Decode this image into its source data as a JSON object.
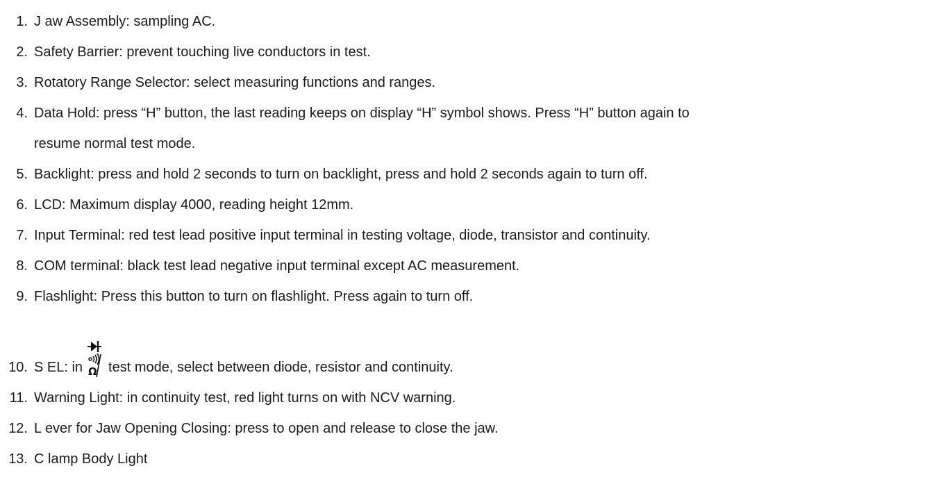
{
  "items": [
    {
      "num": "1.",
      "text": "J aw Assembly: sampling AC."
    },
    {
      "num": "2.",
      "text": "Safety Barrier: prevent touching live conductors in test."
    },
    {
      "num": "3.",
      "text": "Rotatory Range Selector: select measuring functions and ranges."
    },
    {
      "num": "4.",
      "line1": "Data Hold: press “H” button, the last reading keeps on display “H” symbol shows. Press “H” button again to",
      "line2": "resume normal test mode."
    },
    {
      "num": "5.",
      "text": "Backlight: press and hold 2 seconds to turn on backlight, press and hold 2 seconds again to turn off."
    },
    {
      "num": "6.",
      "text": "LCD: Maximum display 4000, reading height 12mm."
    },
    {
      "num": "7.",
      "text": "Input Terminal: red test lead positive input terminal in testing voltage, diode, transistor and continuity."
    },
    {
      "num": "8.",
      "text": "COM terminal: black test lead negative input terminal except AC measurement."
    },
    {
      "num": "9.",
      "text": "Flashlight: Press this button to turn on flashlight. Press again to turn off."
    },
    {
      "num": "10.",
      "before": "S EL: in",
      "icon": "diode-continuity-ohm-icon",
      "after": "test mode, select between diode, resistor and continuity."
    },
    {
      "num": "11.",
      "text": "Warning Light: in continuity test, red light turns on with NCV warning."
    },
    {
      "num": "12.",
      "text": "L ever for Jaw Opening Closing: press to open and release to close the jaw."
    },
    {
      "num": "13.",
      "text": "C lamp Body Light"
    }
  ]
}
